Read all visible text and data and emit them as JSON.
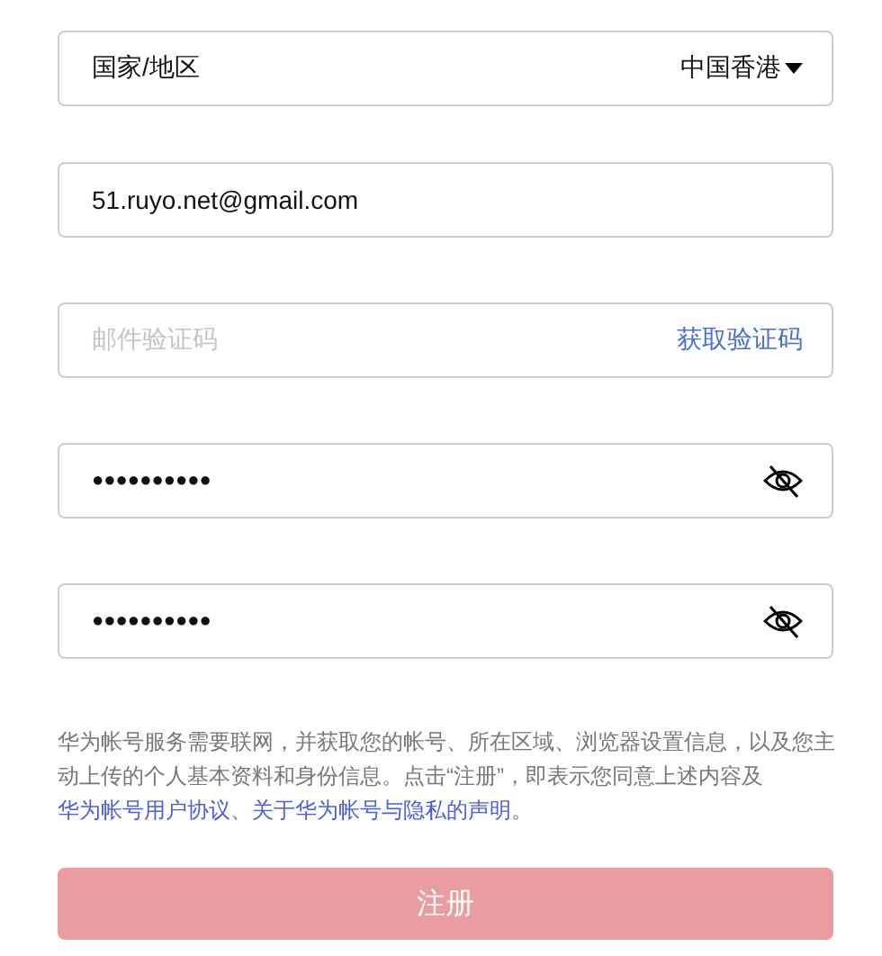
{
  "country": {
    "label": "国家/地区",
    "value": "中国香港"
  },
  "email": {
    "value": "51.ruyo.net@gmail.com"
  },
  "code": {
    "placeholder": "邮件验证码",
    "action": "获取验证码"
  },
  "passwords": [
    {
      "value": "●●●●●●●●●●",
      "masked": true
    },
    {
      "value": "●●●●●●●●●●",
      "masked": true
    }
  ],
  "terms": [
    {
      "kind": "plain",
      "text": "华为帐号服务需要联网，并获取您的帐号、所在区域、浏览器设置信息，以及您主动上传的个人基本资料和身份信息。点击“注册”，即表示您同意上述内容及"
    },
    {
      "kind": "link",
      "text": "华为帐号用户协议"
    },
    {
      "kind": "plain",
      "text": "、"
    },
    {
      "kind": "link",
      "text": "关于华为帐号与隐私的声明"
    },
    {
      "kind": "plain",
      "text": "。"
    }
  ],
  "submit": {
    "label": "注册",
    "disabled": true
  }
}
